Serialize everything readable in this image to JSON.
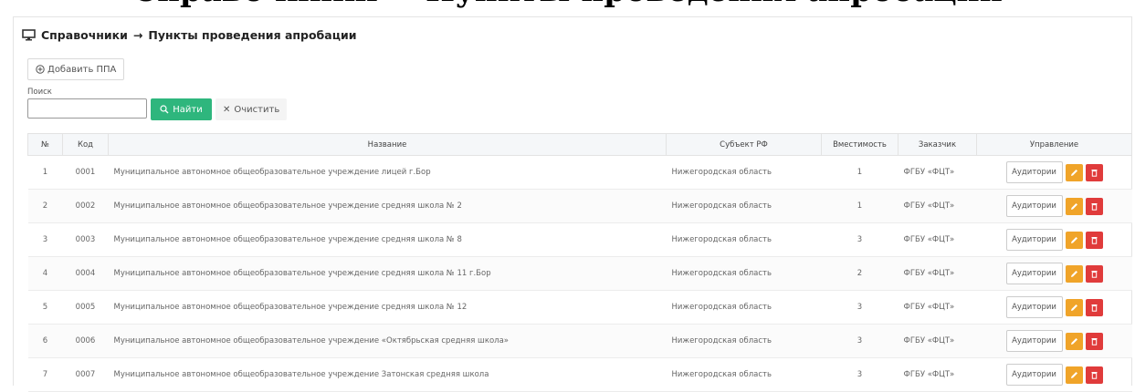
{
  "header": {
    "top_heading": "Справочники → Пункты проведения апробации",
    "breadcrumb_root": "Справочники",
    "breadcrumb_arrow": "→",
    "breadcrumb_page": "Пункты проведения апробации"
  },
  "toolbar": {
    "add_label": "Добавить ППА",
    "search_label": "Поиск",
    "search_value": "",
    "find_label": "Найти",
    "clear_label": "Очистить"
  },
  "table": {
    "columns": [
      "№",
      "Код",
      "Название",
      "Субъект РФ",
      "Вместимость",
      "Заказчик",
      "Управление"
    ],
    "rows": [
      {
        "num": "1",
        "code": "0001",
        "name": "Муниципальное автономное общеобразовательное учреждение лицей г.Бор",
        "region": "Нижегородская область",
        "capacity": "1",
        "customer": "ФГБУ «ФЦТ»"
      },
      {
        "num": "2",
        "code": "0002",
        "name": "Муниципальное автономное общеобразовательное учреждение средняя школа № 2",
        "region": "Нижегородская область",
        "capacity": "1",
        "customer": "ФГБУ «ФЦТ»"
      },
      {
        "num": "3",
        "code": "0003",
        "name": "Муниципальное автономное общеобразовательное учреждение средняя школа № 8",
        "region": "Нижегородская область",
        "capacity": "3",
        "customer": "ФГБУ «ФЦТ»"
      },
      {
        "num": "4",
        "code": "0004",
        "name": "Муниципальное автономное общеобразовательное учреждение средняя школа № 11 г.Бор",
        "region": "Нижегородская область",
        "capacity": "2",
        "customer": "ФГБУ «ФЦТ»"
      },
      {
        "num": "5",
        "code": "0005",
        "name": "Муниципальное автономное общеобразовательное учреждение средняя школа № 12",
        "region": "Нижегородская область",
        "capacity": "3",
        "customer": "ФГБУ «ФЦТ»"
      },
      {
        "num": "6",
        "code": "0006",
        "name": "Муниципальное автономное общеобразовательное учреждение «Октябрьская средняя школа»",
        "region": "Нижегородская область",
        "capacity": "3",
        "customer": "ФГБУ «ФЦТ»"
      },
      {
        "num": "7",
        "code": "0007",
        "name": "Муниципальное автономное общеобразовательное учреждение Затонская средняя школа",
        "region": "Нижегородская область",
        "capacity": "3",
        "customer": "ФГБУ «ФЦТ»"
      }
    ],
    "row_action_label": "Аудитории"
  },
  "icons": {
    "breadcrumb": "monitor-icon",
    "add": "plus-circle-icon",
    "find": "search-icon",
    "clear": "close-icon",
    "edit": "pencil-icon",
    "delete": "trash-icon"
  },
  "colors": {
    "find_button": "#2eb67d",
    "edit_button": "#f0a429",
    "delete_button": "#e03b3b"
  }
}
